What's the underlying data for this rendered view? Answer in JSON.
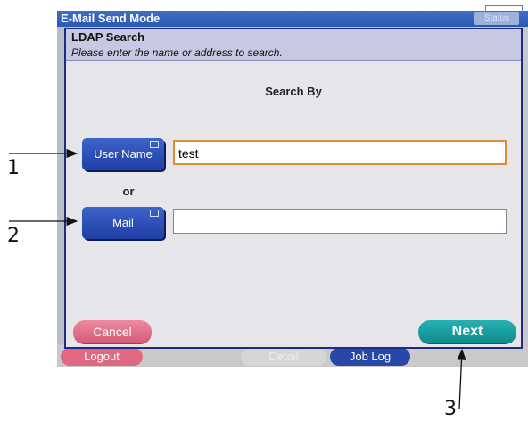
{
  "window": {
    "title": "E-Mail Send Mode",
    "status_label": "Status"
  },
  "dialog": {
    "title": "LDAP Search",
    "subtitle": "Please enter the name or address to search.",
    "search_by_label": "Search By",
    "or_label": "or",
    "username_button": "User Name",
    "mail_button": "Mail",
    "username_value": "test",
    "mail_value": "",
    "cancel_label": "Cancel",
    "next_label": "Next"
  },
  "background_buttons": {
    "logout": "Logout",
    "detail": "Detail",
    "job_log": "Job Log"
  },
  "callouts": [
    "1",
    "2",
    "3"
  ]
}
